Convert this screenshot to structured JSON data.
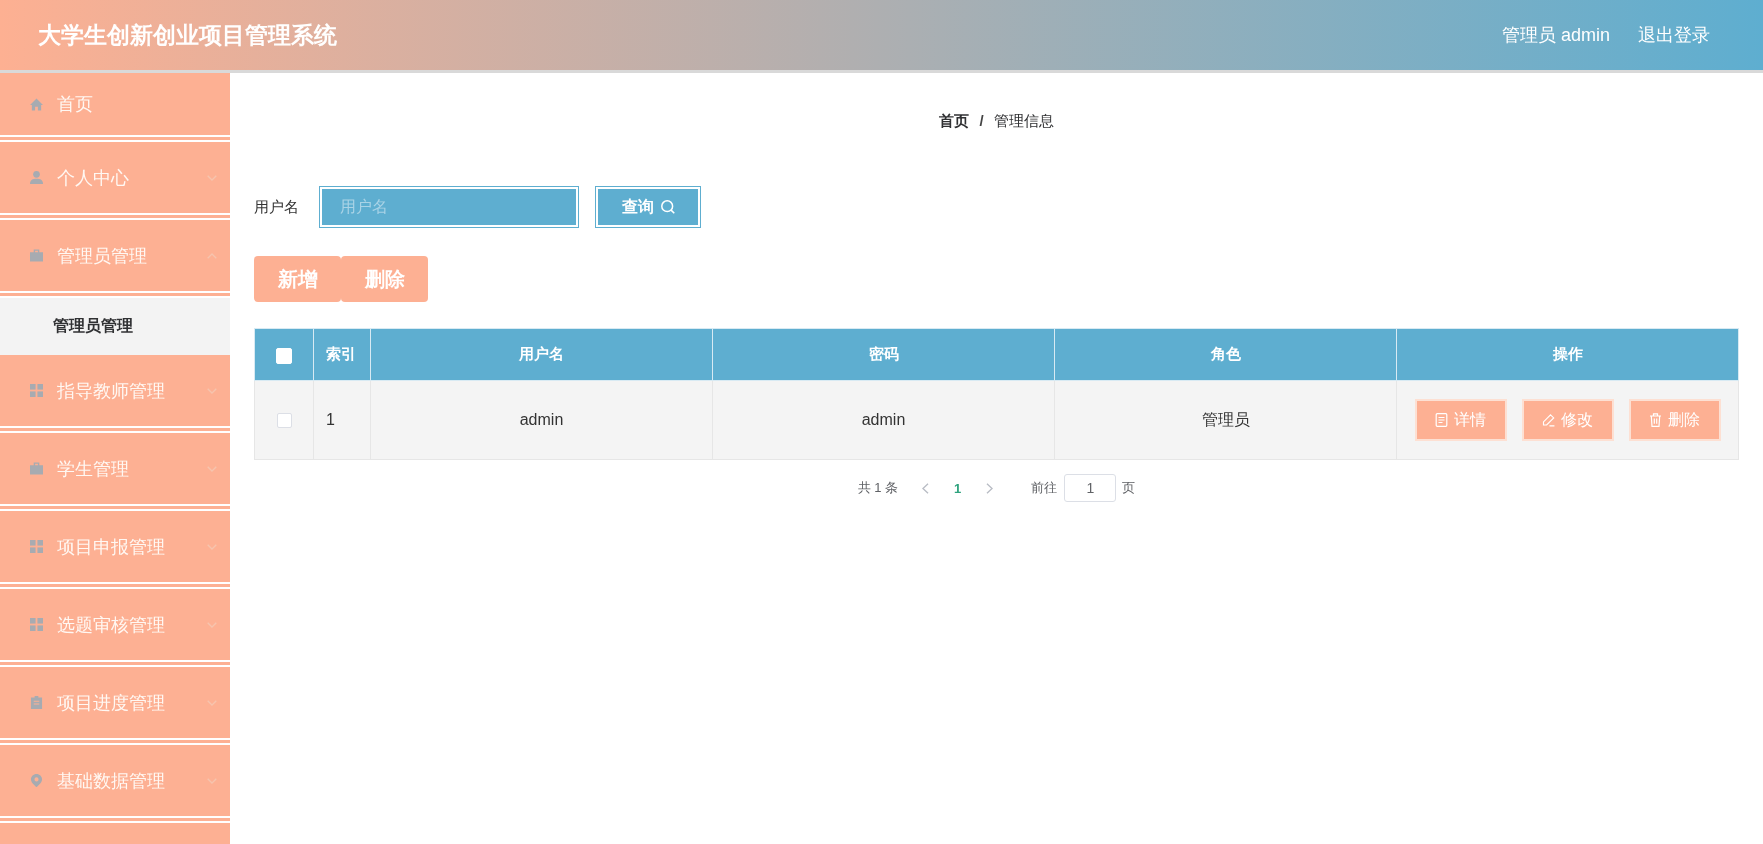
{
  "header": {
    "title": "大学生创新创业项目管理系统",
    "user": "管理员 admin",
    "logout": "退出登录"
  },
  "sidebar": {
    "items": [
      {
        "label": "首页",
        "kind": "link"
      },
      {
        "label": "个人中心",
        "kind": "submenu",
        "expanded": false
      },
      {
        "label": "管理员管理",
        "kind": "submenu",
        "expanded": true,
        "children": [
          {
            "label": "管理员管理",
            "selected": true
          }
        ]
      },
      {
        "label": "指导教师管理",
        "kind": "submenu",
        "expanded": false
      },
      {
        "label": "学生管理",
        "kind": "submenu",
        "expanded": false
      },
      {
        "label": "项目申报管理",
        "kind": "submenu",
        "expanded": false
      },
      {
        "label": "选题审核管理",
        "kind": "submenu",
        "expanded": false
      },
      {
        "label": "项目进度管理",
        "kind": "submenu",
        "expanded": false
      },
      {
        "label": "基础数据管理",
        "kind": "submenu",
        "expanded": false
      }
    ]
  },
  "breadcrumb": {
    "items": [
      {
        "label": "首页",
        "current": false
      },
      {
        "label": "管理信息",
        "current": true
      }
    ],
    "separator": "/"
  },
  "search": {
    "label": "用户名",
    "placeholder": "用户名",
    "button": "查询"
  },
  "toolbar": {
    "buttons": [
      "新增",
      "删除"
    ]
  },
  "table": {
    "select_all_checked": false,
    "columns": [
      "索引",
      "用户名",
      "密码",
      "角色",
      "操作"
    ],
    "rows": [
      {
        "checked": false,
        "cells": [
          "1",
          "admin",
          "admin",
          "管理员"
        ],
        "actions": [
          "详情",
          "修改",
          "删除"
        ]
      }
    ]
  },
  "pagination": {
    "total": "共 1 条",
    "pages": [
      {
        "label": "1",
        "selected": true
      }
    ],
    "goto_label": "前往",
    "goto_value": "1",
    "suffix": "页"
  }
}
